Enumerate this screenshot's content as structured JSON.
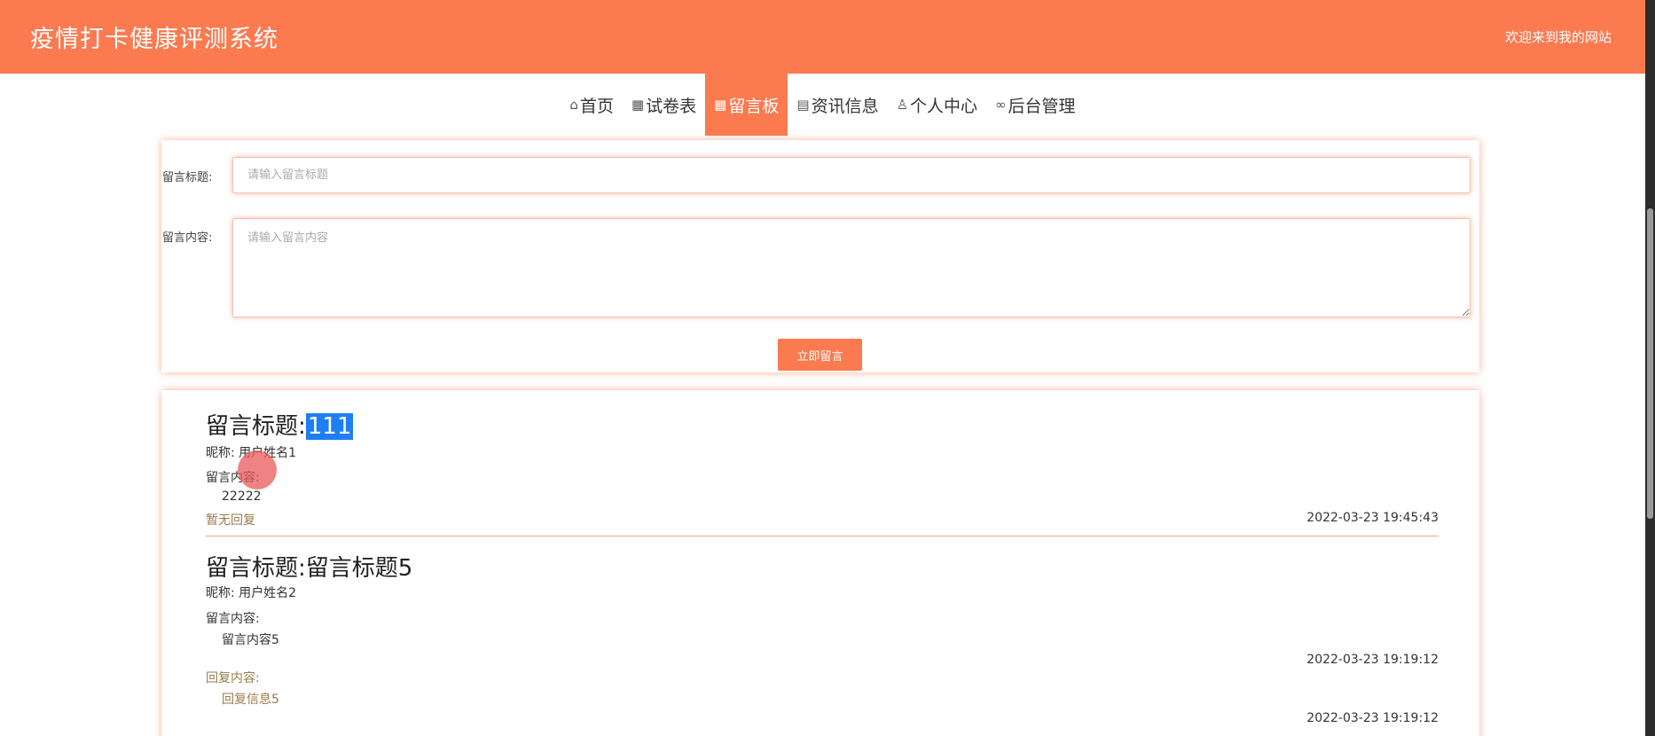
{
  "header": {
    "site_title": "疫情打卡健康评测系统",
    "welcome_text": "欢迎来到我的网站"
  },
  "nav": [
    {
      "icon": "home-icon",
      "glyph": "⌂",
      "label": "首页",
      "active": false
    },
    {
      "icon": "exam-icon",
      "glyph": "▦",
      "label": "试卷表",
      "active": false
    },
    {
      "icon": "message-board-icon",
      "glyph": "▦",
      "label": "留言板",
      "active": true
    },
    {
      "icon": "news-icon",
      "glyph": "▤",
      "label": "资讯信息",
      "active": false
    },
    {
      "icon": "user-icon",
      "glyph": "♙",
      "label": "个人中心",
      "active": false
    },
    {
      "icon": "link-icon",
      "glyph": "∞",
      "label": "后台管理",
      "active": false
    }
  ],
  "form": {
    "title_label": "留言标题:",
    "title_placeholder": "请输入留言标题",
    "content_label": "留言内容:",
    "content_placeholder": "请输入留言内容",
    "submit_label": "立即留言"
  },
  "messages": [
    {
      "title_prefix": "留言标题:",
      "title_value": "111",
      "nickname": "昵称: 用户姓名1",
      "content_label": "留言内容:",
      "content": "22222",
      "reply_status": "暂无回复",
      "time": "2022-03-23 19:45:43"
    },
    {
      "title_prefix": "留言标题:",
      "title_value": "留言标题5",
      "nickname": "昵称: 用户姓名2",
      "content_label": "留言内容:",
      "content": "留言内容5",
      "time": "2022-03-23 19:19:12",
      "reply_label": "回复内容:",
      "reply_content": "回复信息5",
      "reply_time": "2022-03-23 19:19:12"
    }
  ],
  "colors": {
    "primary": "#fc7a4f",
    "selection": "#1e7ff2",
    "reply_text": "#9a7a4a"
  }
}
